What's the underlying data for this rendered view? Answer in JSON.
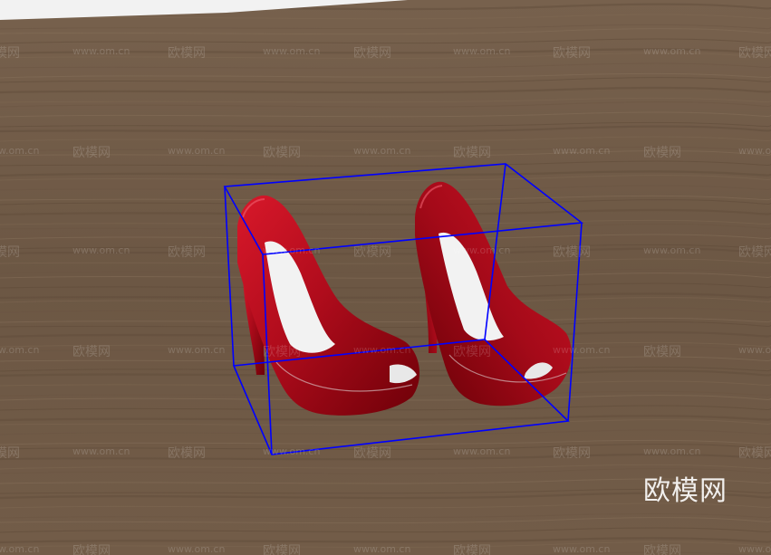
{
  "viewport": {
    "background_color": "#6f5a47",
    "wall_color": "#f2f2f2",
    "selection_box_color": "#0000ff"
  },
  "model": {
    "name": "red peep-toe high heels",
    "shoe_color": "#b00010",
    "lining_color": "#f2f2f2"
  },
  "watermark": {
    "brand_text": "欧模网",
    "url_text": "www.om.cn"
  }
}
